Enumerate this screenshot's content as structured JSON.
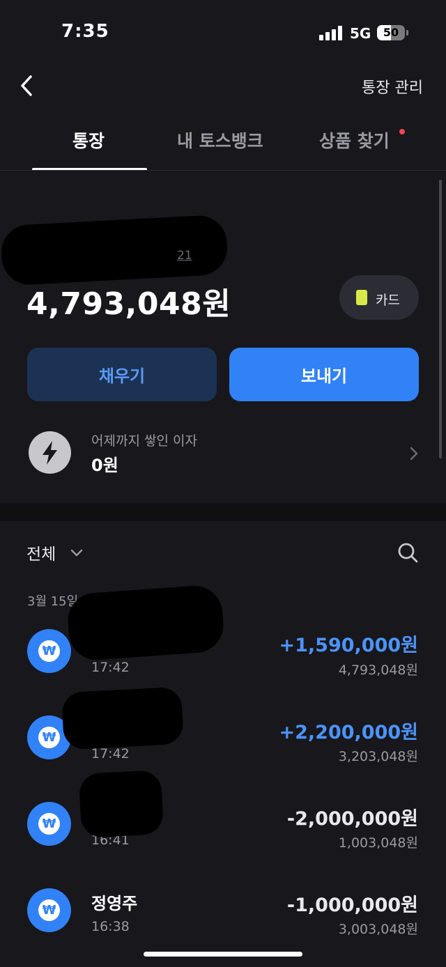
{
  "status_bar": {
    "time": "7:35",
    "network": "5G",
    "battery": "50",
    "battery_level": 0.5
  },
  "header": {
    "manage_label": "통장 관리"
  },
  "tabs": [
    {
      "label": "통장"
    },
    {
      "label": "내 토스뱅크"
    },
    {
      "label": "상품 찾기"
    }
  ],
  "account": {
    "number_fragment": "21",
    "balance": "4,793,048원",
    "card_label": "카드",
    "fill_label": "채우기",
    "send_label": "보내기"
  },
  "interest": {
    "label": "어제까지 쌓인 이자",
    "value": "0원"
  },
  "list": {
    "filter_label": "전체",
    "date_header": "3월 15일",
    "icon_glyph": "₩",
    "transactions": [
      {
        "name": "",
        "time": "17:42",
        "amount": "+1,590,000원",
        "balance": "4,793,048원"
      },
      {
        "name": "",
        "time": "17:42",
        "amount": "+2,200,000원",
        "balance": "3,203,048원"
      },
      {
        "name": "",
        "time": "16:41",
        "amount": "-2,000,000원",
        "balance": "1,003,048원"
      },
      {
        "name": "정영주",
        "time": "16:38",
        "amount": "-1,000,000원",
        "balance": "3,003,048원"
      }
    ]
  },
  "colors": {
    "accent": "#3182f6",
    "positive": "#4c93f7",
    "background": "#17171c",
    "badge": "#f04452"
  }
}
